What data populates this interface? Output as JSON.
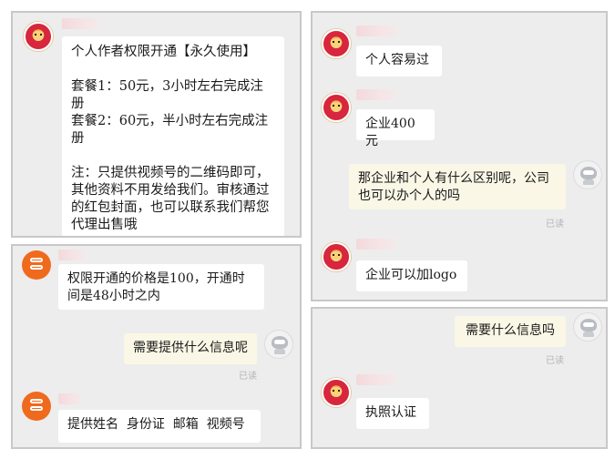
{
  "panels": {
    "top_left": {
      "message": "个人作者权限开通【永久使用】\n\n套餐1：50元，3小时左右完成注册\n套餐2：60元，半小时左右完成注册\n\n注：只提供视频号的二维码即可，其他资料不用发给我们。审核通过的红包封面，也可以联系我们帮您代理出售哦"
    },
    "bottom_left": {
      "msg_price": "权限开通的价格是100，开通时间是48小时之内",
      "msg_ask": "需要提供什么信息呢",
      "read_status": "已读",
      "msg_info": "提供姓名  身份证  邮箱  视频号"
    },
    "top_right": {
      "msg_personal": "个人容易过",
      "msg_enterprise": "企业400元",
      "msg_question": "那企业和个人有什么区别呢，公司也可以办个人的吗",
      "read_status": "已读",
      "msg_logo": "企业可以加logo"
    },
    "bottom_right": {
      "msg_ask": "需要什么信息吗",
      "read_status": "已读",
      "msg_license": "执照认证"
    }
  },
  "avatars": {
    "seller_red": "tiger-mascot-avatar",
    "seller_orange": "orange-logo-avatar",
    "user": "robot-avatar"
  }
}
